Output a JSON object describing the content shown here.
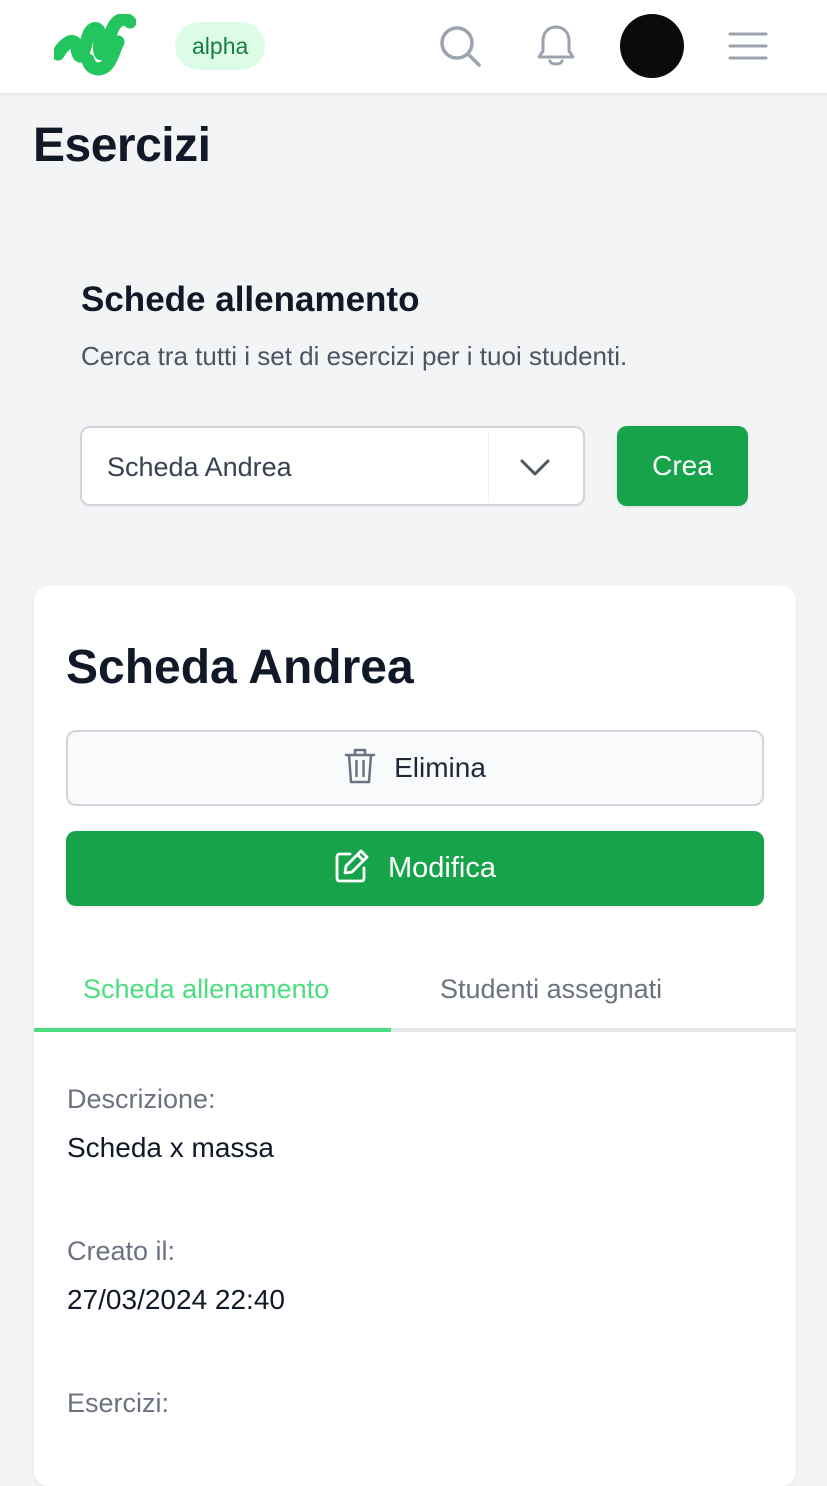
{
  "header": {
    "logo_icon": "brand-logo",
    "badge": "alpha",
    "search_icon": "search-icon",
    "notification_icon": "bell-icon",
    "menu_icon": "hamburger-menu-icon",
    "brand_color": "#22c55e"
  },
  "page": {
    "title": "Esercizi"
  },
  "section": {
    "title": "Schede allenamento",
    "description": "Cerca tra tutti i set di esercizi per i tuoi studenti."
  },
  "selector": {
    "selected": "Scheda Andrea",
    "create_label": "Crea"
  },
  "card": {
    "title": "Scheda Andrea",
    "delete_label": "Elimina",
    "edit_label": "Modifica",
    "tabs": [
      {
        "label": "Scheda allenamento",
        "active": true
      },
      {
        "label": "Studenti assegnati",
        "active": false
      }
    ],
    "fields": {
      "description_label": "Descrizione:",
      "description_value": "Scheda x massa",
      "created_label": "Creato il:",
      "created_value": "27/03/2024 22:40",
      "exercises_label": "Esercizi:"
    }
  },
  "colors": {
    "primary_green": "#16a34a",
    "accent_green": "#4ade80",
    "badge_bg": "#dcfce7"
  }
}
